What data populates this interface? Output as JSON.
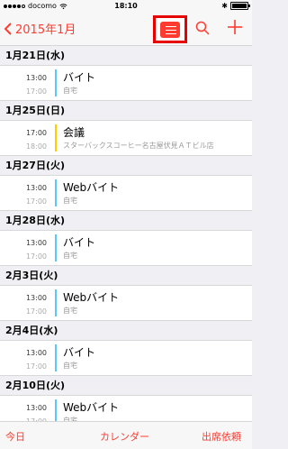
{
  "status": {
    "carrier": "docomo",
    "time": "18:10"
  },
  "nav": {
    "back_label": "2015年1月"
  },
  "colors": {
    "accent": "#ff3b30",
    "work": "#5ac8fa",
    "meeting": "#ffcc00"
  },
  "sections": [
    {
      "date": "1月21日(水)",
      "events": [
        {
          "start": "13:00",
          "end": "17:00",
          "title": "バイト",
          "location": "自宅",
          "color": "#5ac8fa"
        }
      ]
    },
    {
      "date": "1月25日(日)",
      "events": [
        {
          "start": "17:00",
          "end": "18:00",
          "title": "会議",
          "location": "スターバックスコーヒー名古屋伏見ＡＴビル店",
          "color": "#ffcc00"
        }
      ]
    },
    {
      "date": "1月27日(火)",
      "events": [
        {
          "start": "13:00",
          "end": "17:00",
          "title": "Webバイト",
          "location": "自宅",
          "color": "#5ac8fa"
        }
      ]
    },
    {
      "date": "1月28日(水)",
      "events": [
        {
          "start": "13:00",
          "end": "17:00",
          "title": "バイト",
          "location": "自宅",
          "color": "#5ac8fa"
        }
      ]
    },
    {
      "date": "2月3日(火)",
      "events": [
        {
          "start": "13:00",
          "end": "17:00",
          "title": "Webバイト",
          "location": "自宅",
          "color": "#5ac8fa"
        }
      ]
    },
    {
      "date": "2月4日(水)",
      "events": [
        {
          "start": "13:00",
          "end": "17:00",
          "title": "バイト",
          "location": "自宅",
          "color": "#5ac8fa"
        }
      ]
    },
    {
      "date": "2月10日(火)",
      "events": [
        {
          "start": "13:00",
          "end": "17:00",
          "title": "Webバイト",
          "location": "自宅",
          "color": "#5ac8fa"
        }
      ]
    }
  ],
  "tabs": {
    "today": "今日",
    "calendar": "カレンダー",
    "invites": "出席依頼"
  }
}
